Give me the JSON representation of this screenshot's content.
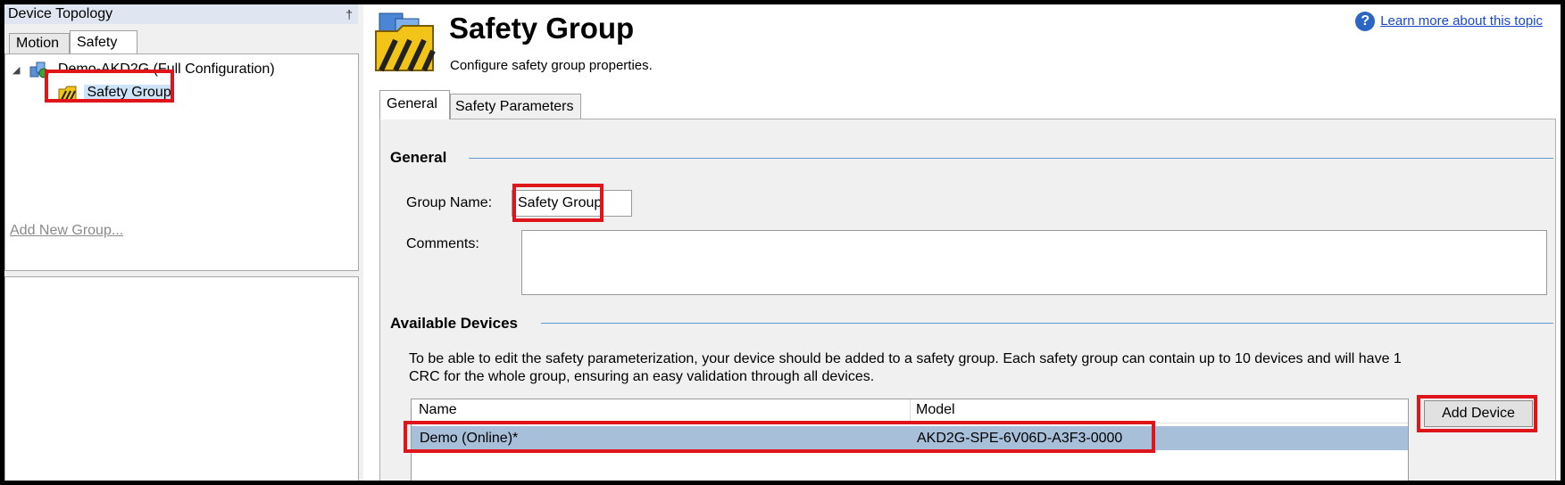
{
  "left_panel": {
    "title": "Device Topology",
    "pin_glyph": "†",
    "tabs": [
      {
        "label": "Motion",
        "active": false
      },
      {
        "label": "Safety",
        "active": true
      }
    ],
    "tree": {
      "root_label": "Demo-AKD2G (Full Configuration)",
      "child_label": "Safety Group",
      "expander_glyph": "◢"
    },
    "add_group_link": "Add New Group..."
  },
  "header": {
    "title": "Safety Group",
    "subtitle": "Configure safety group properties.",
    "help_link": "Learn more about this topic",
    "help_glyph": "?"
  },
  "tabs": [
    {
      "label": "General",
      "active": true
    },
    {
      "label": "Safety Parameters",
      "active": false
    }
  ],
  "general": {
    "heading": "General",
    "group_name_label": "Group Name:",
    "group_name_value": "Safety Group",
    "comments_label": "Comments:",
    "comments_value": ""
  },
  "available_devices": {
    "heading": "Available Devices",
    "description": "To be able to edit the safety parameterization, your device should be added to a safety group.  Each safety group can contain up to 10 devices and will have 1 CRC for the whole group, ensuring an easy validation through all devices.",
    "columns": [
      "Name",
      "Model"
    ],
    "rows": [
      {
        "name": "Demo (Online)*",
        "model": "AKD2G-SPE-6V06D-A3F3-0000"
      }
    ],
    "add_button": "Add Device"
  },
  "colors": {
    "highlight": "#e0141b",
    "selection": "#a7bfd9",
    "section_line": "#5f9bd0",
    "link": "#1a48c8"
  },
  "icons": [
    "pin-icon",
    "device-icon",
    "safety-group-icon",
    "help-icon",
    "safety-group-large-icon",
    "expand-arrow-icon"
  ]
}
